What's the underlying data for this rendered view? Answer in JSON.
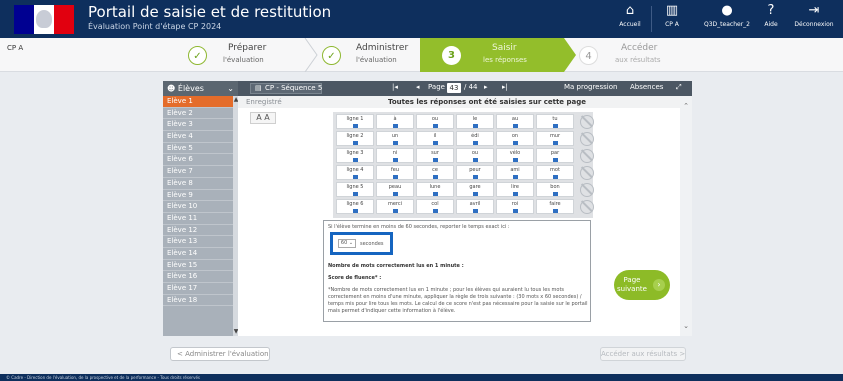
{
  "header": {
    "title": "Portail de saisie et de restitution",
    "subtitle": "Évaluation Point d'étape CP 2024",
    "menu": [
      {
        "label": "Accueil",
        "icon": "home-icon"
      },
      {
        "label": "CP A",
        "icon": "building-icon"
      },
      {
        "label": "Q3D_teacher_2",
        "icon": "user-icon"
      },
      {
        "label": "Aide",
        "icon": "help-icon"
      },
      {
        "label": "Déconnexion",
        "icon": "logout-icon"
      }
    ]
  },
  "subheader": {
    "class_label": "CP A",
    "steps": [
      {
        "number": "✓",
        "line1": "Préparer",
        "line2": "l'évaluation",
        "state": "done"
      },
      {
        "number": "✓",
        "line1": "Administrer",
        "line2": "l'évaluation",
        "state": "done"
      },
      {
        "number": "3",
        "line1": "Saisir",
        "line2": "les réponses",
        "state": "current"
      },
      {
        "number": "4",
        "line1": "Accéder",
        "line2": "aux résultats",
        "state": "todo"
      }
    ]
  },
  "students_header": "Élèves",
  "students": [
    "Elève 1",
    "Elève 2",
    "Elève 3",
    "Elève 4",
    "Elève 5",
    "Elève 6",
    "Elève 7",
    "Elève 8",
    "Elève 9",
    "Elève 10",
    "Elève 11",
    "Elève 12",
    "Elève 13",
    "Elève 14",
    "Elève 15",
    "Elève 16",
    "Elève 17",
    "Elève 18"
  ],
  "toolbar": {
    "sequence": "CP - Séquence 5",
    "page_label": "Page",
    "page_current": "43",
    "page_total": "/ 44",
    "progression": "Ma progression",
    "absences": "Absences"
  },
  "content": {
    "saved_label": "Enregistré",
    "status": "Toutes les réponses ont été saisies sur cette page",
    "font_toggle": "A A",
    "rows": [
      {
        "label": "ligne 1",
        "words": [
          "à",
          "ou",
          "le",
          "au",
          "tu"
        ]
      },
      {
        "label": "ligne 2",
        "words": [
          "un",
          "il",
          "édi",
          "on",
          "mur"
        ]
      },
      {
        "label": "ligne 3",
        "words": [
          "ni",
          "sur",
          "ou",
          "vélo",
          "par"
        ]
      },
      {
        "label": "ligne 4",
        "words": [
          "feu",
          "ce",
          "peur",
          "ami",
          "mot"
        ]
      },
      {
        "label": "ligne 5",
        "words": [
          "peau",
          "lune",
          "gare",
          "lire",
          "bon"
        ]
      },
      {
        "label": "ligne 6",
        "words": [
          "merci",
          "col",
          "avril",
          "roi",
          "faire"
        ]
      }
    ],
    "time_intro": "Si l'élève termine en moins de 60 secondes, reporter le temps exact ici :",
    "seconds_value": "60",
    "seconds_label": "secondes",
    "words_read_label": "Nombre de mots correctement lus en 1 minute :",
    "fluency_label": "Score de fluence* :",
    "fluency_note": "*Nombre de mots correctement lus en 1 minute ; pour les élèves qui auraient lu tous les mots correctement en moins d'une minute, appliquer la règle de trois suivante : (30 mots x 60 secondes) / temps mis pour lire tous les mots. Le calcul de ce score n'est pas nécessaire pour la saisie sur le portail mais permet d'indiquer cette information à l'élève.",
    "next_page": "Page suivante"
  },
  "footer_nav": {
    "back": "< Administrer l'évaluation",
    "forward": "Accéder aux résultats >"
  },
  "footer_text": "© Cadre - Direction de l'évaluation, de la prospective et de la performance - Tous droits réservés"
}
